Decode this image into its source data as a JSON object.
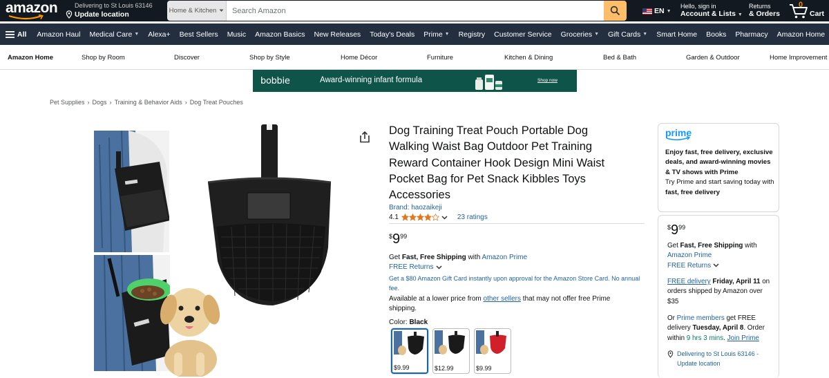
{
  "header": {
    "logo": "amazon",
    "deliver_line1": "Delivering to St Louis 63146",
    "deliver_line2": "Update location",
    "search_dept": "Home & Kitchen",
    "search_placeholder": "Search Amazon",
    "language": "EN",
    "account_line1": "Hello, sign in",
    "account_line2": "Account & Lists",
    "returns_line1": "Returns",
    "returns_line2": "& Orders",
    "cart_count": "0",
    "cart_label": "Cart"
  },
  "main_nav": {
    "all_label": "All",
    "items": [
      {
        "label": "Amazon Haul",
        "dropdown": false
      },
      {
        "label": "Medical Care",
        "dropdown": true
      },
      {
        "label": "Alexa+",
        "dropdown": false
      },
      {
        "label": "Best Sellers",
        "dropdown": false
      },
      {
        "label": "Music",
        "dropdown": false
      },
      {
        "label": "Amazon Basics",
        "dropdown": false
      },
      {
        "label": "New Releases",
        "dropdown": false
      },
      {
        "label": "Today's Deals",
        "dropdown": false
      },
      {
        "label": "Prime",
        "dropdown": true
      },
      {
        "label": "Registry",
        "dropdown": false
      },
      {
        "label": "Customer Service",
        "dropdown": false
      },
      {
        "label": "Groceries",
        "dropdown": true
      },
      {
        "label": "Gift Cards",
        "dropdown": true
      },
      {
        "label": "Smart Home",
        "dropdown": false
      },
      {
        "label": "Books",
        "dropdown": false
      },
      {
        "label": "Pharmacy",
        "dropdown": false
      },
      {
        "label": "Amazon Home",
        "dropdown": false
      }
    ]
  },
  "sub_nav": {
    "items": [
      "Amazon Home",
      "Shop by Room",
      "Discover",
      "Shop by Style",
      "Home Décor",
      "Furniture",
      "Kitchen & Dining",
      "Bed & Bath",
      "Garden & Outdoor",
      "Home Improvement"
    ]
  },
  "banner": {
    "brand": "bobbie",
    "tagline": "Award-winning infant formula",
    "cta": "Shop now",
    "bg_color": "#0f5449"
  },
  "breadcrumb": [
    "Pet Supplies",
    "Dogs",
    "Training & Behavior Aids",
    "Dog Treat Pouches"
  ],
  "product": {
    "title": "Dog Training Treat Pouch Portable Dog Walking Waist Bag Outdoor Pet Training Reward Container Hook Design Mini Waist Pocket Bag for Pet Snack Kibbles Toys Accessories",
    "brand_link": "Brand: haozaikeji",
    "rating_value": "4.1",
    "rating_stars": 4.1,
    "rating_count": "23 ratings",
    "price_symbol": "$",
    "price_whole": "9",
    "price_fraction": "99",
    "shipping_prefix": "Get ",
    "shipping_bold": "Fast, Free Shipping",
    "shipping_mid": " with ",
    "shipping_link": "Amazon Prime",
    "free_returns": "FREE Returns",
    "gift_card": "Get a $80 Amazon Gift Card instantly upon approval for the Amazon Store Card. No annual fee.",
    "lower_price_prefix": "Available at a lower price from ",
    "lower_price_link": "other sellers",
    "lower_price_suffix": " that may not offer free Prime shipping.",
    "color_label": "Color: ",
    "color_value": "Black",
    "swatches": [
      {
        "price": "$9.99",
        "selected": true,
        "accent": "#1a1a1a"
      },
      {
        "price": "$12.99",
        "selected": false,
        "accent": "#1a1a1a"
      },
      {
        "price": "$9.99",
        "selected": false,
        "accent": "#d0202a"
      }
    ]
  },
  "prime_box": {
    "logo": "prime",
    "line1_bold": "Enjoy fast, free delivery, exclusive deals, and award-winning movies & TV shows with Prime",
    "line2": "Try Prime and start saving today with ",
    "line2_bold": "fast, free delivery"
  },
  "buy_box": {
    "price_symbol": "$",
    "price_whole": "9",
    "price_fraction": "99",
    "ship_prefix": "Get ",
    "ship_bold": "Fast, Free Shipping",
    "ship_mid": " with",
    "ship_link": "Amazon Prime",
    "free_returns": "FREE Returns",
    "delivery_link": "FREE delivery",
    "delivery_date": " Friday, April 11",
    "delivery_suffix": " on orders shipped by Amazon over $35",
    "or": "Or ",
    "members_link": "Prime members",
    "members_mid": " get FREE delivery ",
    "members_date": "Tuesday, April 8",
    "members_order": ". Order within ",
    "members_time": "9 hrs 3 mins",
    "members_dot": ". ",
    "join_link": "Join Prime",
    "location": "Delivering to St Louis 63146 - Update location"
  },
  "colors": {
    "nav_dark": "#131921",
    "nav_secondary": "#232f3e",
    "search_button": "#febd69",
    "link": "#2162a1",
    "star": "#de7921",
    "prime_blue": "#1399ff"
  }
}
